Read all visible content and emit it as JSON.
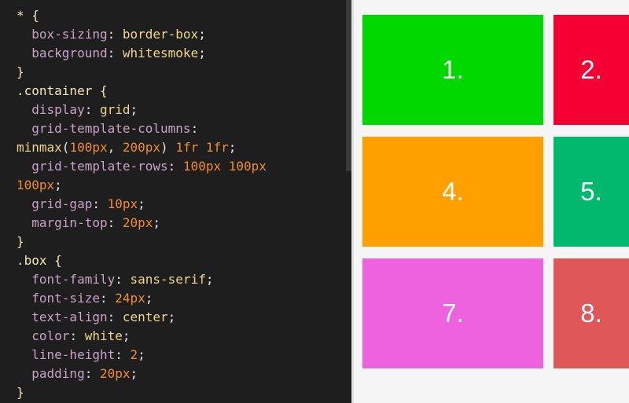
{
  "code": {
    "l1": {
      "a": "* {"
    },
    "l2": {
      "p": "box-sizing",
      "c": ": ",
      "v": "border-box",
      "e": ";"
    },
    "l3": {
      "p": "background",
      "c": ": ",
      "v": "whitesmoke",
      "e": ";"
    },
    "l4": {
      "a": "}"
    },
    "l5": {
      "a": ".container {"
    },
    "l6": {
      "p": "display",
      "c": ": ",
      "v": "grid",
      "e": ";"
    },
    "l7": {
      "p": "grid-template-columns",
      "c": ":"
    },
    "l8": {
      "f": "minmax",
      "o": "(",
      "n1": "100px",
      "s": ", ",
      "n2": "200px",
      "cl": ")",
      "sp": " ",
      "n3": "1fr",
      "sp2": " ",
      "n4": "1fr",
      "e": ";"
    },
    "l9": {
      "p": "grid-template-rows",
      "c": ": ",
      "n1": "100px",
      "sp": " ",
      "n2": "100px"
    },
    "l10": {
      "n": "100px",
      "e": ";"
    },
    "l11": {
      "p": "grid-gap",
      "c": ": ",
      "n": "10px",
      "e": ";"
    },
    "l12": {
      "p": "margin-top",
      "c": ": ",
      "n": "20px",
      "e": ";"
    },
    "l13": {
      "a": "}"
    },
    "l14": {
      "a": ".box {"
    },
    "l15": {
      "p": "font-family",
      "c": ": ",
      "v": "sans-serif",
      "e": ";"
    },
    "l16": {
      "p": "font-size",
      "c": ": ",
      "n": "24px",
      "e": ";"
    },
    "l17": {
      "p": "text-align",
      "c": ": ",
      "v": "center",
      "e": ";"
    },
    "l18": {
      "p": "color",
      "c": ": ",
      "v": "white",
      "e": ";"
    },
    "l19": {
      "p": "line-height",
      "c": ": ",
      "n": "2",
      "e": ";"
    },
    "l20": {
      "p": "padding",
      "c": ": ",
      "n": "20px",
      "e": ";"
    },
    "l21": {
      "a": "}"
    }
  },
  "preview": {
    "boxes": [
      {
        "label": "1.",
        "color": "#00d800"
      },
      {
        "label": "2.",
        "color": "#f50034"
      },
      {
        "label": "4.",
        "color": "#ffa000"
      },
      {
        "label": "5.",
        "color": "#00b86e"
      },
      {
        "label": "7.",
        "color": "#ee62df"
      },
      {
        "label": "8.",
        "color": "#e05757"
      }
    ]
  },
  "colors": {
    "editor_bg": "#1e1e1e",
    "selector": "#f5e6b8",
    "property": "#c8a2c8",
    "keyword": "#f0d58a",
    "number": "#f08d2a",
    "preview_bg": "#f5f5f5"
  }
}
